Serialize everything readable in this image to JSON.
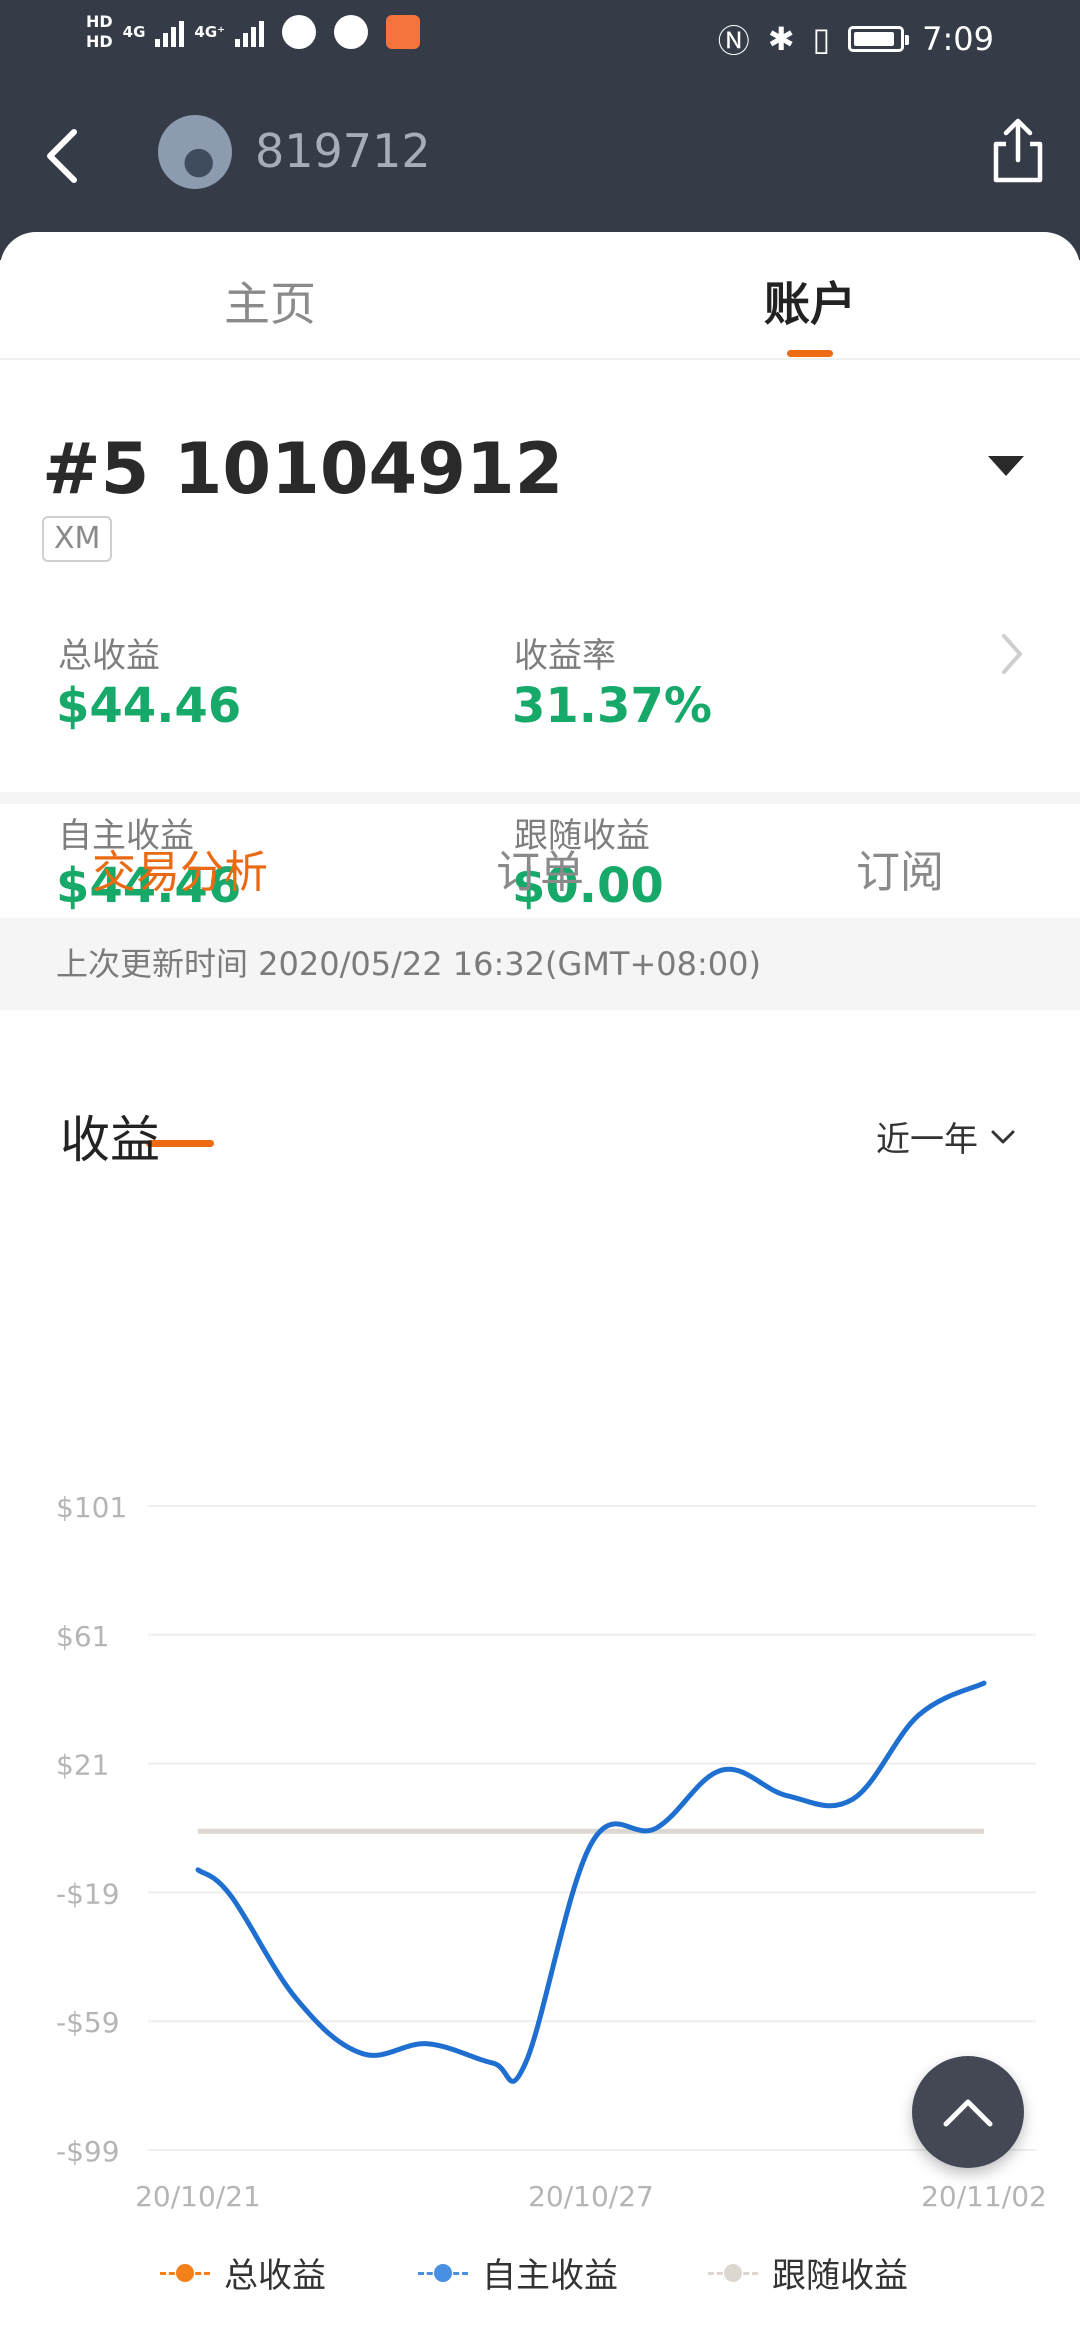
{
  "status_bar": {
    "network_1": "4G",
    "network_2": "4G⁺",
    "time": "7:09"
  },
  "header": {
    "title": "819712",
    "icons": [
      "back-arrow-icon",
      "avatar",
      "share-icon"
    ]
  },
  "main_tabs": [
    {
      "label": "主页",
      "active": false
    },
    {
      "label": "账户",
      "active": true
    }
  ],
  "account": {
    "title": "#5 10104912",
    "broker": "XM",
    "stats": [
      {
        "label": "总收益",
        "value": "$44.46"
      },
      {
        "label": "收益率",
        "value": "31.37%"
      },
      {
        "label": "自主收益",
        "value": "$44.46"
      },
      {
        "label": "跟随收益",
        "value": "$0.00"
      }
    ]
  },
  "sub_tabs": [
    {
      "label": "交易分析",
      "active": true
    },
    {
      "label": "订单",
      "active": false
    },
    {
      "label": "订阅",
      "active": false
    }
  ],
  "update_text": "上次更新时间 2020/05/22 16:32(GMT+08:00)",
  "chart_section": {
    "title": "收益",
    "range": "近一年"
  },
  "colors": {
    "accent": "#ea6a13",
    "positive": "#17a96a",
    "header_bg": "#353c48",
    "series_self": "#1f6fd0",
    "series_follow": "#dcd7d0",
    "series_total": "#f4801a"
  },
  "chart_data": {
    "type": "line",
    "x_labels": [
      "20/10/21",
      "20/10/27",
      "20/11/02"
    ],
    "y_ticks": [
      {
        "value": 101,
        "label": "$101"
      },
      {
        "value": 61,
        "label": "$61"
      },
      {
        "value": 21,
        "label": "$21"
      },
      {
        "value": -19,
        "label": "-$19"
      },
      {
        "value": -59,
        "label": "-$59"
      },
      {
        "value": -99,
        "label": "-$99"
      }
    ],
    "ylim": [
      -99,
      101
    ],
    "grid": true,
    "legend_position": "bottom",
    "x_index_range": [
      0,
      12
    ],
    "series": [
      {
        "name": "总收益",
        "color": "#f4801a",
        "marker": "dot",
        "values": []
      },
      {
        "name": "自主收益",
        "color": "#1f6fd0",
        "marker": "dot",
        "x": [
          0,
          0.5,
          1.5,
          2.5,
          3.5,
          4.5,
          5.0,
          6.0,
          7.0,
          8.0,
          9.0,
          10.0,
          11.0,
          12.0
        ],
        "values": [
          -12,
          -20,
          -52,
          -69,
          -66,
          -72,
          -72,
          -4,
          1,
          19,
          11,
          10,
          36,
          46
        ]
      },
      {
        "name": "跟随收益",
        "color": "#dcd7d0",
        "marker": "dot",
        "x": [
          0,
          12
        ],
        "values": [
          0,
          0
        ]
      }
    ]
  }
}
